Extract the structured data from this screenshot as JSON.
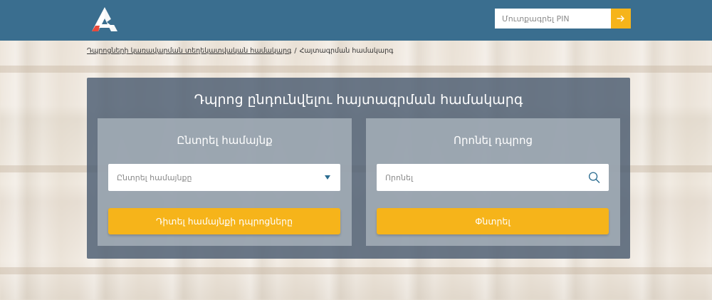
{
  "header": {
    "logo_icon": "school-logo-icon",
    "pin_input": {
      "value": "",
      "placeholder": "Մուտքագրել PIN"
    },
    "pin_submit_icon": "arrow-right-icon",
    "color": "#3a6e8f"
  },
  "breadcrumb": {
    "link": "Դպրոցների կառավարման տեղեկատվական համակարգ",
    "separator": "/",
    "current": "Հայտագրման համակարգ"
  },
  "panel": {
    "title": "Դպրոց ընդունվելու հայտագրման համակարգ"
  },
  "left_card": {
    "title": "Ընտրել համայնք",
    "select_value": "Ընտրել համայնքը",
    "select_icon": "caret-down-icon",
    "button_label": "Դիտել համայնքի դպրոցները"
  },
  "right_card": {
    "title": "Որոնել դպրոց",
    "search_input": {
      "value": "",
      "placeholder": "Որոնել"
    },
    "search_icon": "search-icon",
    "button_label": "Փնտրել"
  },
  "colors": {
    "accent": "#f6b41a",
    "link_icon": "#2b6c90"
  }
}
